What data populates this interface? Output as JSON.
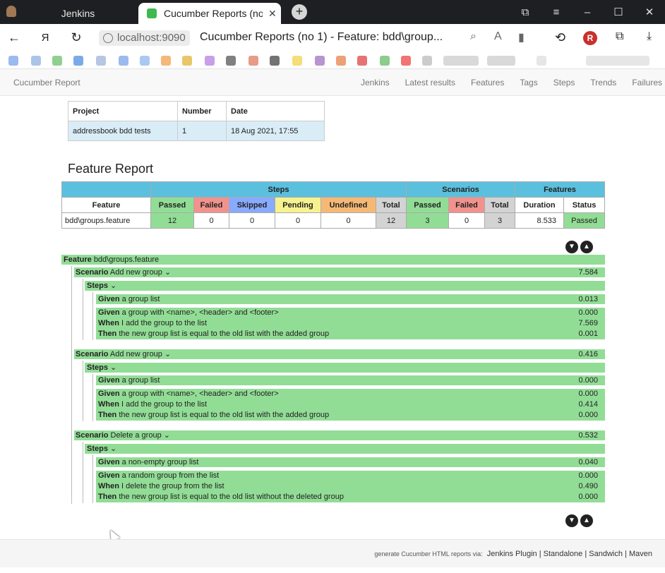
{
  "browser": {
    "tabs": [
      {
        "label": "Jenkins"
      },
      {
        "label": "Cucumber Reports (no 1)"
      }
    ],
    "url_host": "localhost:9090",
    "page_title": "Cucumber Reports (no 1) - Feature: bdd\\group..."
  },
  "report_nav": {
    "brand": "Cucumber Report",
    "links": [
      "Jenkins",
      "Latest results",
      "Features",
      "Tags",
      "Steps",
      "Trends",
      "Failures"
    ]
  },
  "project_table": {
    "headers": [
      "Project",
      "Number",
      "Date"
    ],
    "row": [
      "addressbook bdd tests",
      "1",
      "18 Aug 2021, 17:55"
    ]
  },
  "heading": "Feature Report",
  "stats_table": {
    "groups": [
      "Steps",
      "Scenarios",
      "Features"
    ],
    "columns": [
      "Feature",
      "Passed",
      "Failed",
      "Skipped",
      "Pending",
      "Undefined",
      "Total",
      "Passed",
      "Failed",
      "Total",
      "Duration",
      "Status"
    ],
    "row": [
      "bdd\\groups.feature",
      "12",
      "0",
      "0",
      "0",
      "0",
      "12",
      "3",
      "0",
      "3",
      "8.533",
      "Passed"
    ]
  },
  "feature": {
    "keyword": "Feature",
    "name": "bdd\\groups.feature",
    "scenarios": [
      {
        "keyword": "Scenario",
        "name": "Add new group",
        "duration": "7.584",
        "steps_label": "Steps",
        "background": {
          "keyword": "Given",
          "text": "a group list",
          "duration": "0.013"
        },
        "steps": [
          {
            "keyword": "Given",
            "text": "a group with <name>, <header> and <footer>",
            "duration": "0.000"
          },
          {
            "keyword": "When",
            "text": "I add the group to the list",
            "duration": "7.569"
          },
          {
            "keyword": "Then",
            "text": "the new group list is equal to the old list with the added group",
            "duration": "0.001"
          }
        ]
      },
      {
        "keyword": "Scenario",
        "name": "Add new group",
        "duration": "0.416",
        "steps_label": "Steps",
        "background": {
          "keyword": "Given",
          "text": "a group list",
          "duration": "0.000"
        },
        "steps": [
          {
            "keyword": "Given",
            "text": "a group with <name>, <header> and <footer>",
            "duration": "0.000"
          },
          {
            "keyword": "When",
            "text": "I add the group to the list",
            "duration": "0.414"
          },
          {
            "keyword": "Then",
            "text": "the new group list is equal to the old list with the added group",
            "duration": "0.000"
          }
        ]
      },
      {
        "keyword": "Scenario",
        "name": "Delete a group",
        "duration": "0.532",
        "steps_label": "Steps",
        "background": {
          "keyword": "Given",
          "text": "a non-empty group list",
          "duration": "0.040"
        },
        "steps": [
          {
            "keyword": "Given",
            "text": "a random group from the list",
            "duration": "0.000"
          },
          {
            "keyword": "When",
            "text": "I delete the group from the list",
            "duration": "0.490"
          },
          {
            "keyword": "Then",
            "text": "the new group list is equal to the old list without the deleted group",
            "duration": "0.000"
          }
        ]
      }
    ]
  },
  "footer": {
    "prefix": "generate Cucumber HTML reports via:",
    "links": [
      "Jenkins Plugin",
      "Standalone",
      "Sandwich",
      "Maven"
    ]
  },
  "colors": {
    "passed": "#92dd96",
    "failed": "#f2928c",
    "skipped": "#88aaff",
    "pending": "#f5f28f",
    "undefined": "#f5b975",
    "header": "#5bc0de"
  }
}
